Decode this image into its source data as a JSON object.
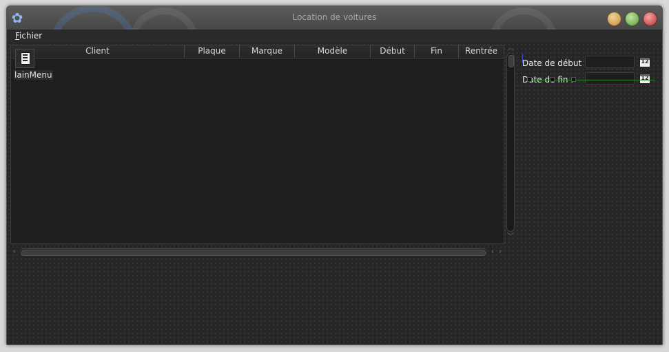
{
  "window": {
    "title": "Location de voitures"
  },
  "menubar": {
    "items": [
      {
        "mnemonic": "F",
        "rest": "ichier"
      }
    ]
  },
  "table": {
    "columns": [
      "Client",
      "Plaque",
      "Marque",
      "Modèle",
      "Début",
      "Fin",
      "Rentrée"
    ],
    "rows": []
  },
  "main_menu": {
    "label": "lainMenu",
    "icon": "document-menu-icon"
  },
  "filters": {
    "start_label": "Date de début :",
    "start_value": "",
    "end_label": "Date de fin :",
    "end_value": "",
    "calendar_text": "12"
  },
  "colors": {
    "background": "#262626",
    "title_text": "#a9a9a9",
    "minimize": "#c48a38",
    "maximize": "#5f9a3a",
    "close": "#b83232"
  }
}
